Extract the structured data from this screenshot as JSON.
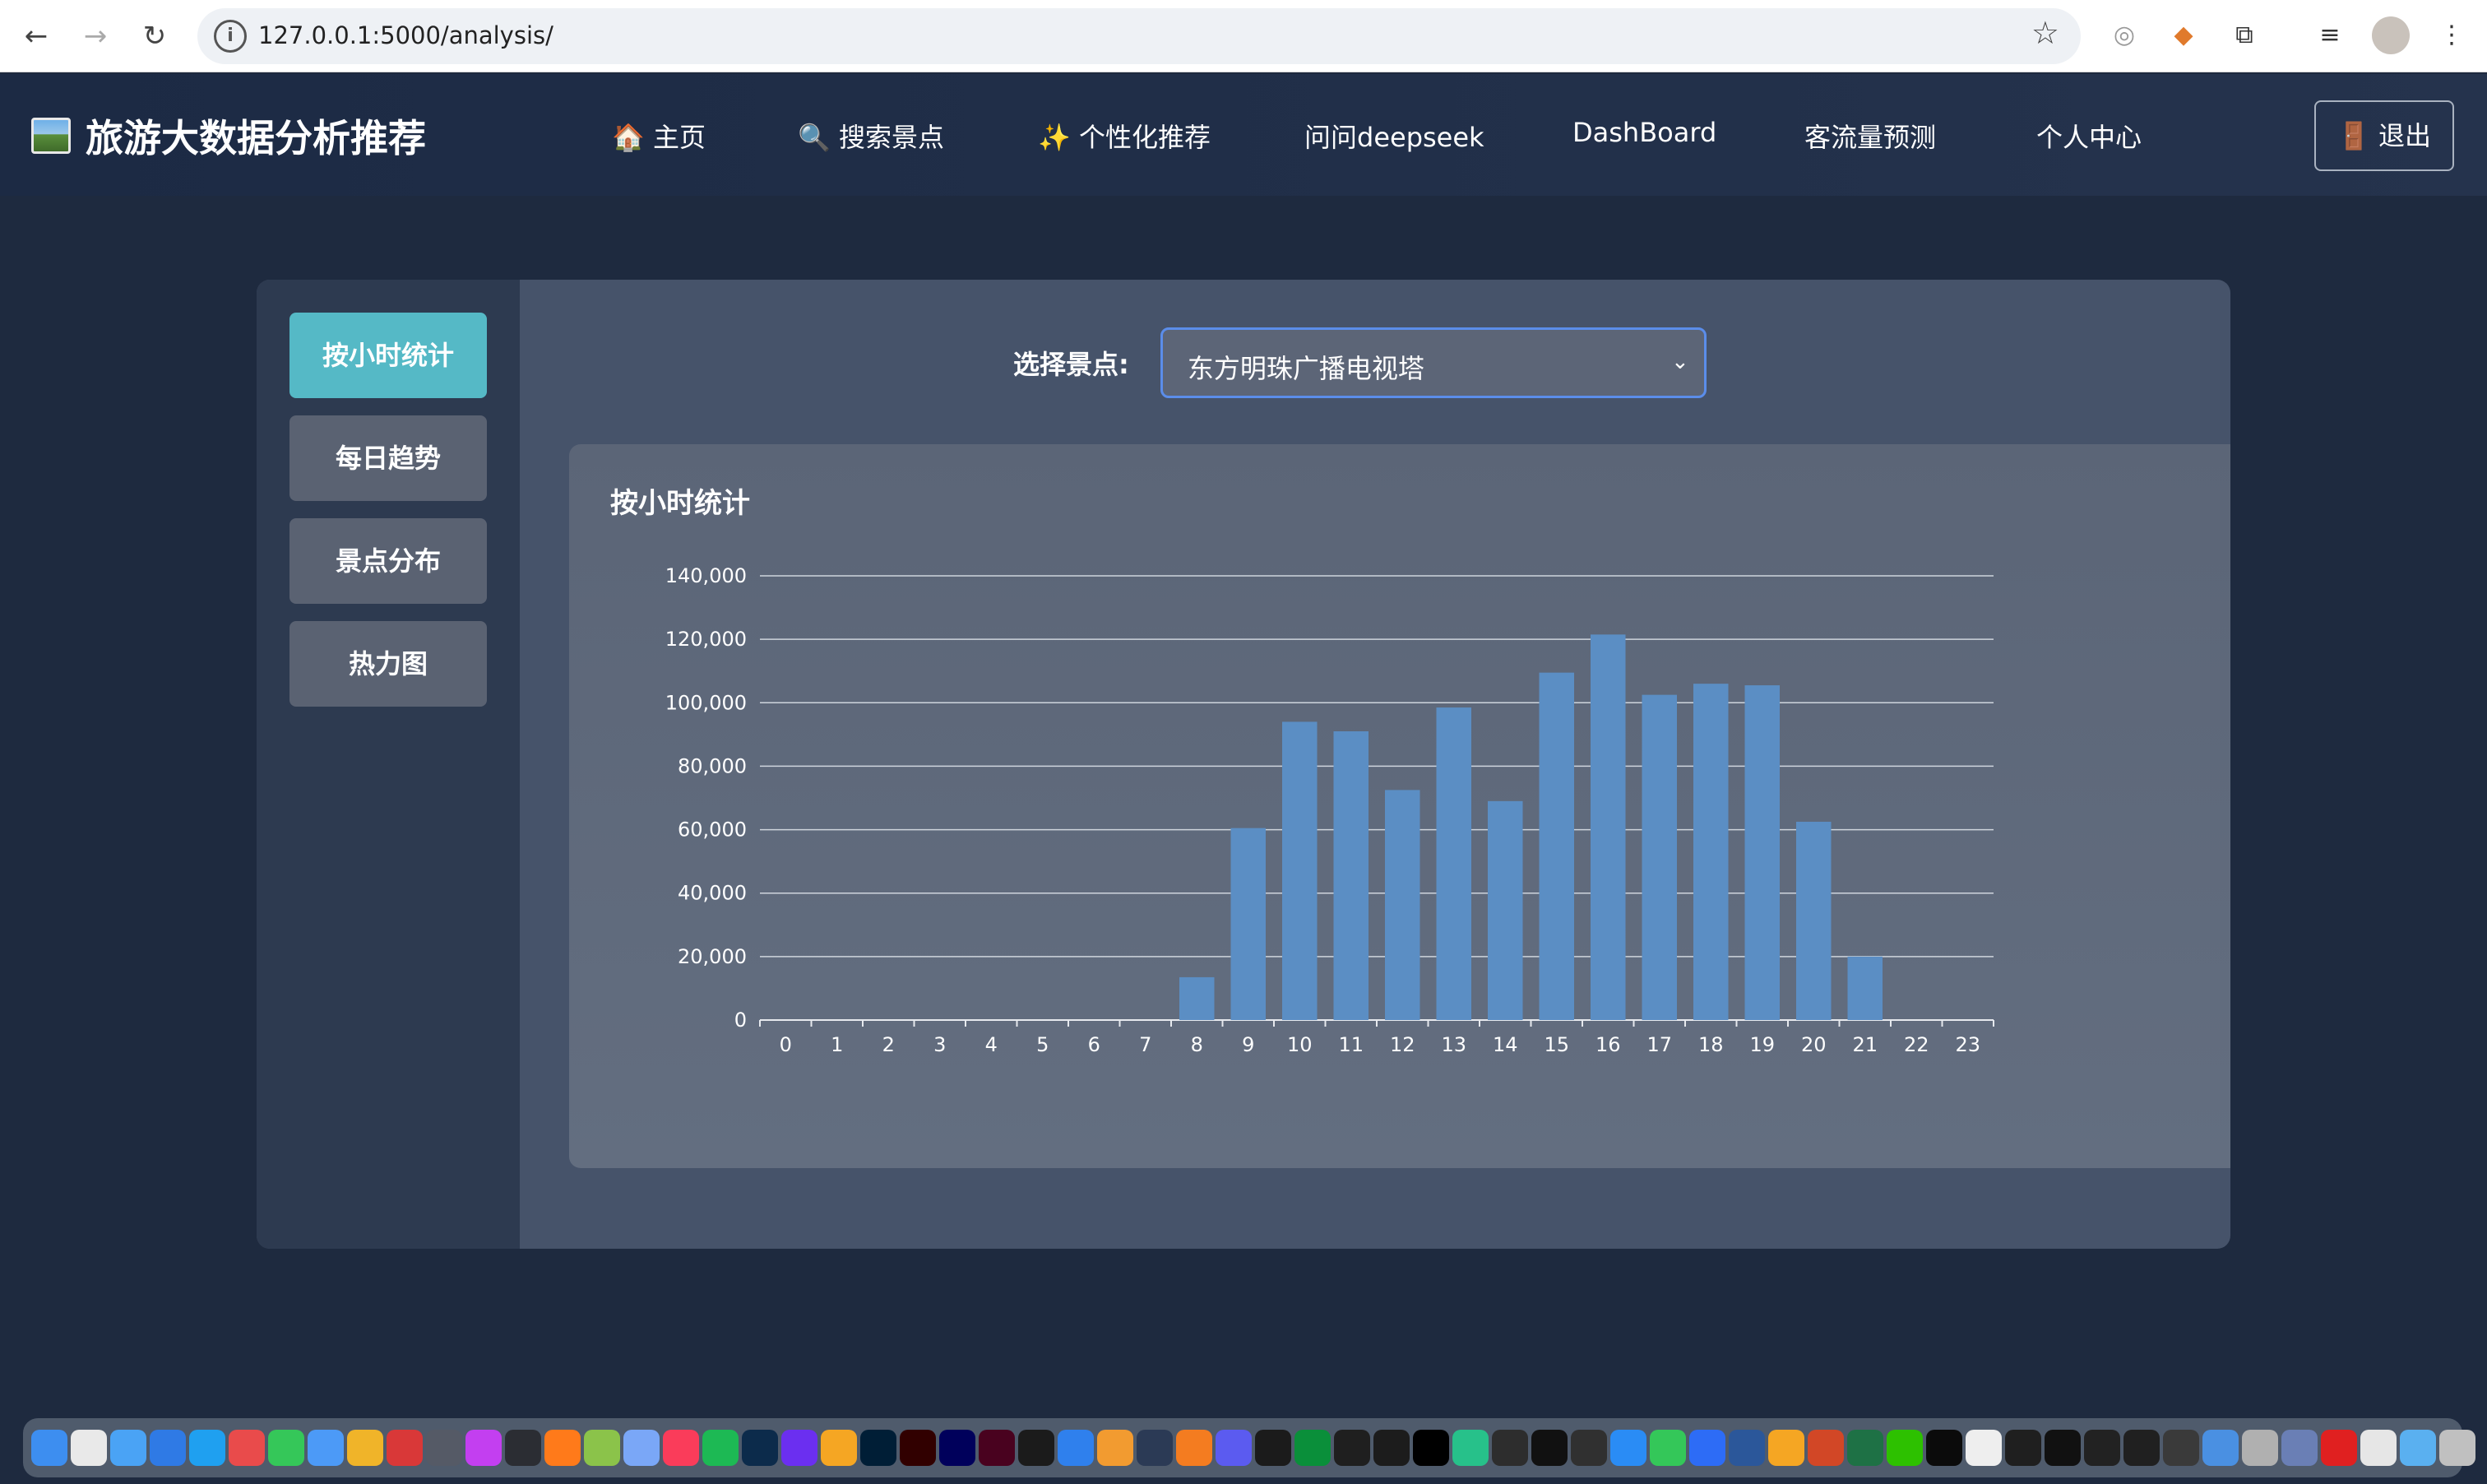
{
  "browser": {
    "url": "127.0.0.1:5000/analysis/"
  },
  "header": {
    "brand": "旅游大数据分析推荐",
    "nav": [
      {
        "icon": "house-emoji",
        "label": "🏠 主页"
      },
      {
        "icon": "magnifier-emoji",
        "label": "🔍 搜索景点"
      },
      {
        "icon": "sparkles-emoji",
        "label": "✨ 个性化推荐"
      },
      {
        "label": "问问deepseek"
      },
      {
        "label": "DashBoard"
      },
      {
        "label": "客流量预测"
      },
      {
        "label": "个人中心"
      }
    ],
    "logout": "🚪 退出"
  },
  "sidebar": {
    "items": [
      {
        "label": "按小时统计",
        "active": true
      },
      {
        "label": "每日趋势"
      },
      {
        "label": "景点分布"
      },
      {
        "label": "热力图"
      }
    ]
  },
  "filter": {
    "label": "选择景点:",
    "selected": "东方明珠广播电视塔"
  },
  "chart_data": {
    "type": "bar",
    "title": "按小时统计",
    "categories": [
      "0",
      "1",
      "2",
      "3",
      "4",
      "5",
      "6",
      "7",
      "8",
      "9",
      "10",
      "11",
      "12",
      "13",
      "14",
      "15",
      "16",
      "17",
      "18",
      "19",
      "20",
      "21",
      "22",
      "23"
    ],
    "values": [
      0,
      0,
      0,
      0,
      0,
      0,
      0,
      0,
      13500,
      60500,
      94000,
      91000,
      72500,
      98500,
      69000,
      109500,
      121500,
      102500,
      106000,
      105500,
      62500,
      20000,
      0,
      0
    ],
    "ylim": [
      0,
      140000
    ],
    "yticks": [
      "0",
      "20,000",
      "40,000",
      "60,000",
      "80,000",
      "100,000",
      "120,000",
      "140,000"
    ],
    "grid": true,
    "bar_color": "#5b8ec4"
  },
  "colors": {
    "accent_active": "#55b9c6",
    "header_bg": "#1c2a44"
  }
}
